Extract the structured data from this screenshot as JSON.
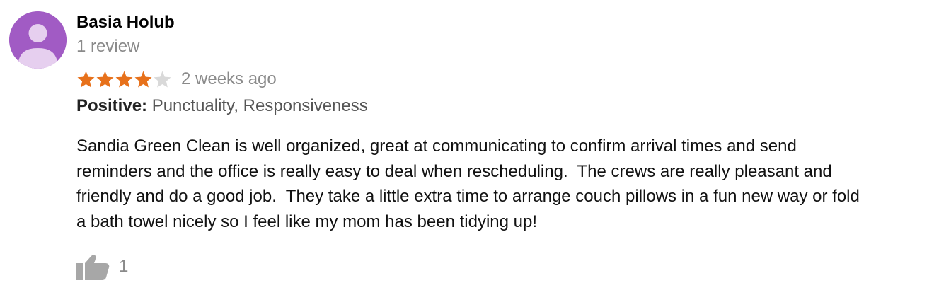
{
  "review": {
    "reviewer_name": "Basia Holub",
    "review_count": "1 review",
    "rating": 4,
    "rating_max": 5,
    "time_ago": "2 weeks ago",
    "attributes_label": "Positive:",
    "attributes_values": " Punctuality, Responsiveness",
    "text_lines": [
      "Sandia Green Clean is well organized, great at communicating to confirm arrival times and send",
      "reminders and the office is really easy to deal when rescheduling.  The crews are really pleasant and",
      "friendly and do a good job.  They take a little extra time to arrange couch pillows in a fun new way or fold",
      "a bath towel nicely so I feel like my mom has been tidying up!"
    ],
    "like_count": "1"
  },
  "icons": {
    "avatar": "default-person-icon",
    "star_filled": "star-icon",
    "star_empty": "star-outline-icon",
    "like": "thumbs-up-icon"
  },
  "colors": {
    "avatar_bg": "#a15bc4",
    "star_filled": "#e7711b",
    "star_empty": "#d9d9d9",
    "muted_text": "#8a8a8a",
    "like_icon": "#a7a7a7"
  }
}
